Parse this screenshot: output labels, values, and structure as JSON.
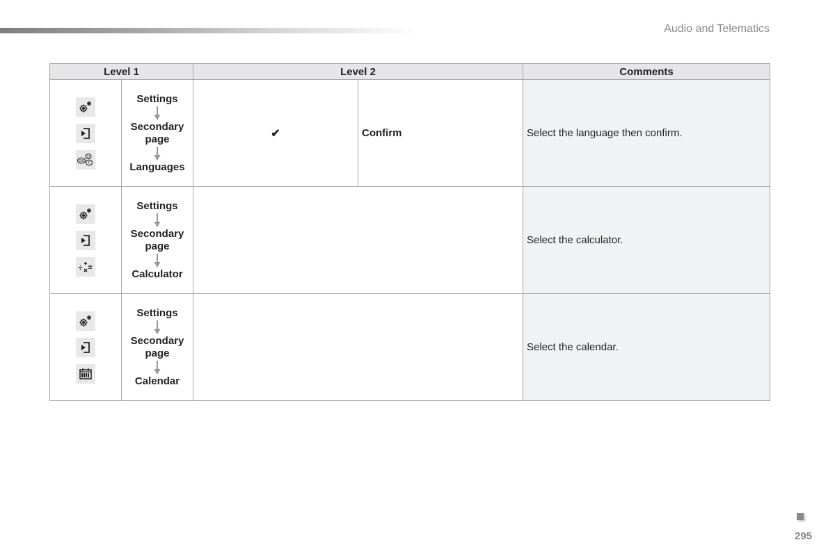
{
  "header": {
    "section_title": "Audio and Telematics"
  },
  "table": {
    "columns": [
      "Level 1",
      "Level 2",
      "Comments"
    ],
    "rows": [
      {
        "icons": [
          "settings-icon",
          "secondary-page-icon",
          "languages-icon"
        ],
        "level1_path": [
          "Settings",
          "Secondary page",
          "Languages"
        ],
        "level2_check": "✔",
        "level2_label": "Confirm",
        "comment": "Select the language then confirm."
      },
      {
        "icons": [
          "settings-icon",
          "secondary-page-icon",
          "calculator-icon"
        ],
        "level1_path": [
          "Settings",
          "Secondary page",
          "Calculator"
        ],
        "comment": "Select the calculator."
      },
      {
        "icons": [
          "settings-icon",
          "secondary-page-icon",
          "calendar-icon"
        ],
        "level1_path": [
          "Settings",
          "Secondary page",
          "Calendar"
        ],
        "comment": "Select the calendar."
      }
    ]
  },
  "footer": {
    "page_number": "295"
  }
}
